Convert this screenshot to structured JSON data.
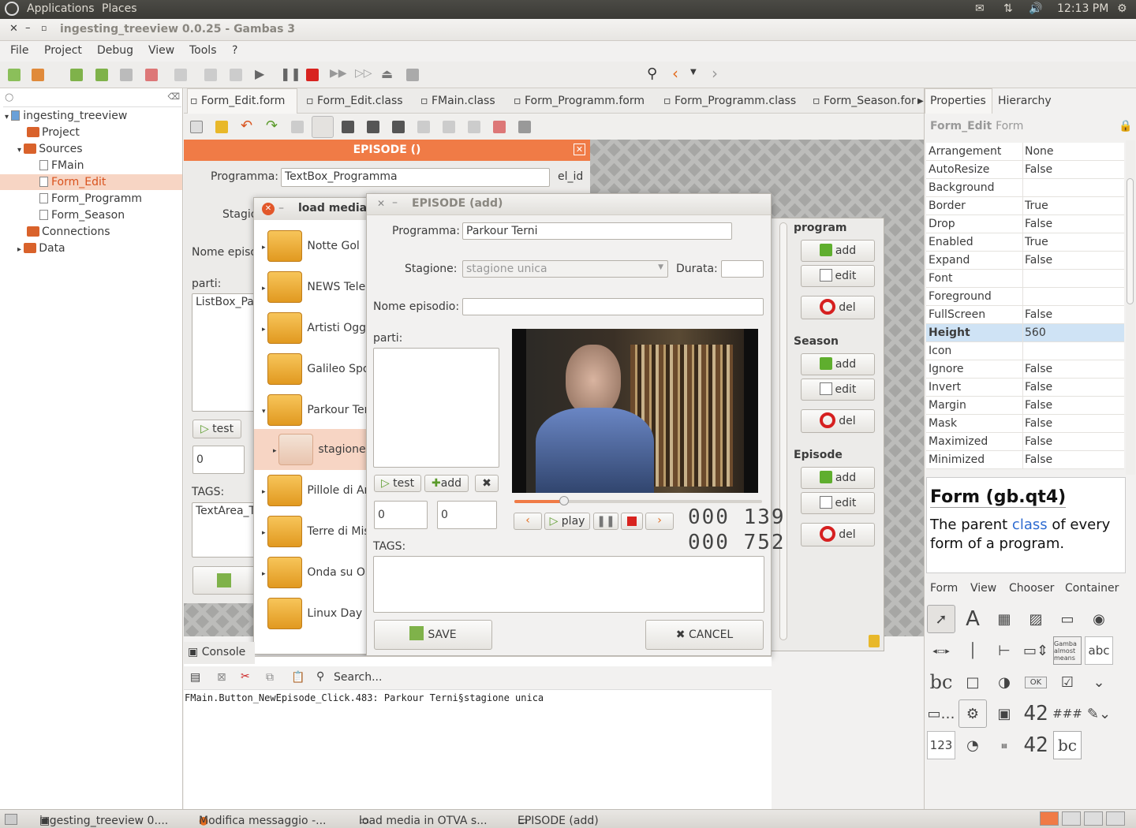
{
  "topbar": {
    "applications": "Applications",
    "places": "Places",
    "time": "12:13 PM"
  },
  "window": {
    "title": "ingesting_treeview 0.0.25 - Gambas 3"
  },
  "menu": [
    "File",
    "Project",
    "Debug",
    "View",
    "Tools",
    "?"
  ],
  "project_tree": {
    "root": "ingesting_treeview",
    "project": "Project",
    "sources": "Sources",
    "items": [
      "FMain",
      "Form_Edit",
      "Form_Programm",
      "Form_Season"
    ],
    "connections": "Connections",
    "data": "Data"
  },
  "tabs": [
    "Form_Edit.form",
    "Form_Edit.class",
    "FMain.class",
    "Form_Programm.form",
    "Form_Programm.class",
    "Form_Season.for"
  ],
  "orange_form": {
    "title": "EPISODE ()",
    "programma_label": "Programma:",
    "programma_value": "TextBox_Programma",
    "el_id": "el_id",
    "stagione": "Stagio",
    "nome_episodio": "Nome episo",
    "parti": "parti:",
    "listbox": "ListBox_Pa",
    "test": "test",
    "zero": "0",
    "tags": "TAGS:",
    "textarea": "TextArea_T"
  },
  "load_media": {
    "title": "load media i",
    "items": [
      "Notte Gol",
      "NEWS Tele",
      "Artisti Ogg",
      "Galileo Spo",
      "Parkour Ter",
      "stagione",
      "Pillole di Ar",
      "Terre di Mis",
      "Onda su Or",
      "Linux Day"
    ]
  },
  "episode_dialog": {
    "title": "EPISODE (add)",
    "programma_label": "Programma:",
    "programma_value": "Parkour Terni",
    "stagione_label": "Stagione:",
    "stagione_value": "stagione unica",
    "durata_label": "Durata:",
    "nome_label": "Nome episodio:",
    "parti_label": "parti:",
    "test": "test",
    "add": "add",
    "spin1": "0",
    "spin2": "0",
    "play": "play",
    "counter1": "000 139",
    "counter2": "000 752",
    "tags_label": "TAGS:",
    "save": "SAVE",
    "cancel": "CANCEL",
    "progress": 0.2
  },
  "side_buttons": {
    "program": "program",
    "season": "Season",
    "episode": "Episode",
    "add": "add",
    "edit": "edit",
    "del": "del"
  },
  "console": {
    "tab": "Console",
    "search": "Search...",
    "output": "FMain.Button_NewEpisode_Click.483: Parkour Terni§stagione unica"
  },
  "properties": {
    "tab1": "Properties",
    "tab2": "Hierarchy",
    "header": "Form_Edit",
    "header_type": "Form",
    "rows": [
      [
        "Arrangement",
        "None"
      ],
      [
        "AutoResize",
        "False"
      ],
      [
        "Background",
        ""
      ],
      [
        "Border",
        "True"
      ],
      [
        "Drop",
        "False"
      ],
      [
        "Enabled",
        "True"
      ],
      [
        "Expand",
        "False"
      ],
      [
        "Font",
        ""
      ],
      [
        "Foreground",
        ""
      ],
      [
        "FullScreen",
        "False"
      ],
      [
        "Height",
        "560"
      ],
      [
        "Icon",
        ""
      ],
      [
        "Ignore",
        "False"
      ],
      [
        "Invert",
        "False"
      ],
      [
        "Margin",
        "False"
      ],
      [
        "Mask",
        "False"
      ],
      [
        "Maximized",
        "False"
      ],
      [
        "Minimized",
        "False"
      ]
    ],
    "help_title": "Form (gb.qt4)",
    "help_pre": "The parent ",
    "help_link": "class",
    "help_post": " of every form of a program."
  },
  "toolbox": {
    "tabs": [
      "Form",
      "View",
      "Chooser",
      "Container"
    ],
    "lcd": "42",
    "lcd2": "42",
    "hash": "###",
    "abc": "abc",
    "num": "123",
    "ok": "OK"
  },
  "taskbar": [
    "ingesting_treeview 0....",
    "Modifica messaggio -...",
    "load media in OTVA s...",
    "EPISODE (add)"
  ],
  "colors": {
    "accent": "#f07b46",
    "selection": "#f7d5c4",
    "link": "#2d6bd1"
  }
}
